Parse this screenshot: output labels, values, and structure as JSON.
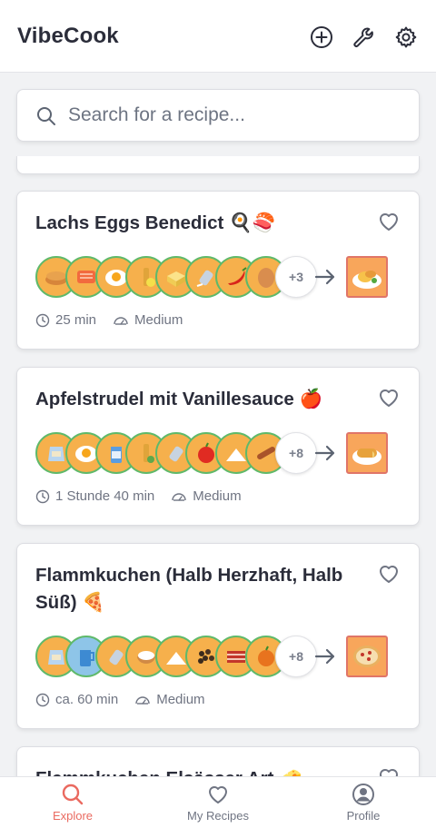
{
  "header": {
    "app_title": "VibeCook",
    "actions": [
      "plus-circle-icon",
      "wrench-icon",
      "gear-icon"
    ]
  },
  "search": {
    "placeholder": "Search for a recipe..."
  },
  "recipes": [
    {
      "title": "Lachs Eggs Benedict 🍳🍣",
      "ingredients": [
        "pancake",
        "salmon",
        "egg",
        "oil-lemon",
        "butter",
        "salt",
        "chili",
        "egg-brown"
      ],
      "more": "+3",
      "result": "eggs-benedict-plate",
      "time": "25 min",
      "difficulty": "Medium"
    },
    {
      "title": "Apfelstrudel mit Vanillesauce 🍎",
      "ingredients": [
        "flour-sack",
        "egg",
        "milk",
        "oil",
        "salt",
        "apple",
        "sugar",
        "cinnamon"
      ],
      "more": "+8",
      "result": "apfelstrudel-plate",
      "time": "1 Stunde 40 min",
      "difficulty": "Medium"
    },
    {
      "title": "Flammkuchen (Halb Herzhaft, Halb Süß) 🍕",
      "ingredients": [
        "flour-sack",
        "water",
        "salt",
        "creme",
        "sugar",
        "spices",
        "bacon",
        "onion"
      ],
      "more": "+8",
      "result": "flammkuchen-plate",
      "time": "ca. 60 min",
      "difficulty": "Medium"
    },
    {
      "title": "Flammkuchen Elsässer Art 🧀"
    }
  ],
  "nav": [
    {
      "label": "Explore",
      "icon": "search-icon",
      "active": true
    },
    {
      "label": "My Recipes",
      "icon": "heart-icon",
      "active": false
    },
    {
      "label": "Profile",
      "icon": "user-circle-icon",
      "active": false
    }
  ],
  "colors": {
    "accent": "#ea6a60",
    "ingredient_border": "#5fb96a",
    "ingredient_bg": "#f6b04c",
    "result_bg": "#f8a65b",
    "result_border": "#e07568"
  }
}
